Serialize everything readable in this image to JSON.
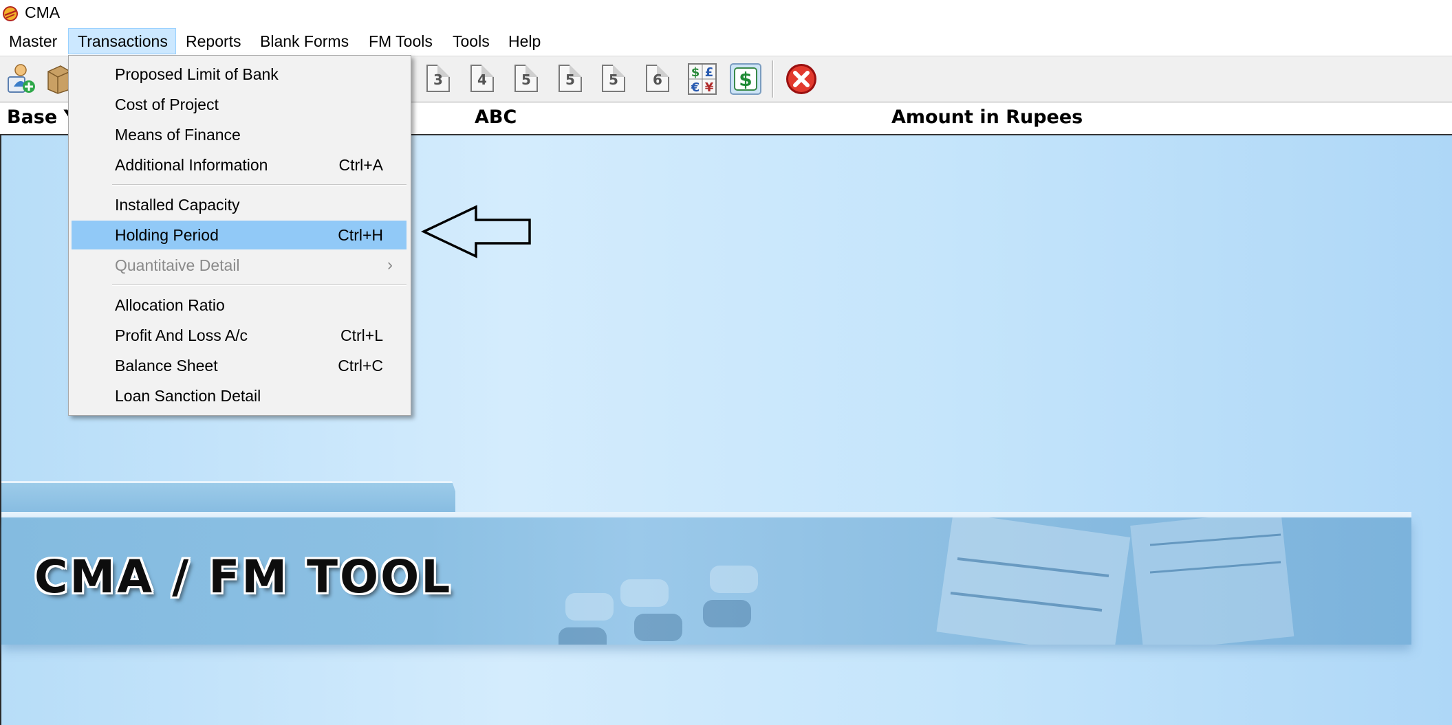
{
  "window": {
    "title": "CMA"
  },
  "menubar": {
    "items": [
      "Master",
      "Transactions",
      "Reports",
      "Blank Forms",
      "FM Tools",
      "Tools",
      "Help"
    ],
    "active": "Transactions"
  },
  "toolbar": {
    "icons": [
      "add-user-icon",
      "package-icon",
      "form-3-icon",
      "form-4-icon",
      "form-5-icon",
      "form-5-icon",
      "form-5-icon",
      "form-6-icon",
      "currency-icon",
      "dollar-icon",
      "close-icon"
    ],
    "doc_numbers": [
      "3",
      "4",
      "5",
      "5",
      "5",
      "6"
    ],
    "currency_glyphs": [
      "$",
      "£",
      "€",
      "¥"
    ],
    "dollar_glyph": "$"
  },
  "header": {
    "base_label": "Base Y",
    "company": "ABC",
    "amount_label": "Amount in Rupees"
  },
  "dropdown": {
    "items": [
      {
        "label": "Proposed Limit of Bank",
        "shortcut": ""
      },
      {
        "label": "Cost of Project",
        "shortcut": ""
      },
      {
        "label": "Means of Finance",
        "shortcut": ""
      },
      {
        "label": "Additional Information",
        "shortcut": "Ctrl+A"
      },
      {
        "label": "Installed Capacity",
        "shortcut": ""
      },
      {
        "label": "Holding Period",
        "shortcut": "Ctrl+H",
        "highlighted": true
      },
      {
        "label": "Quantitaive Detail",
        "shortcut": "",
        "disabled": true,
        "submenu": true
      },
      {
        "label": "Allocation Ratio",
        "shortcut": ""
      },
      {
        "label": "Profit And Loss A/c",
        "shortcut": "Ctrl+L"
      },
      {
        "label": "Balance Sheet",
        "shortcut": "Ctrl+C"
      },
      {
        "label": "Loan Sanction Detail",
        "shortcut": ""
      }
    ]
  },
  "banner": {
    "title": "CMA / FM TOOL"
  },
  "colors": {
    "highlight": "#91c9f7",
    "menu_active_bg": "#cce8ff",
    "background": "#c5e5fb",
    "banner": "#84bbe0"
  }
}
